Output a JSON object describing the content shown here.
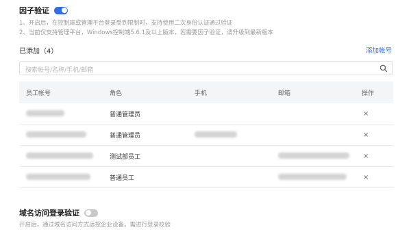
{
  "factor_auth": {
    "title": "因子验证",
    "enabled": true,
    "notes": [
      "1、开启后，在控制端或管理平台登录受到限制时，支持使用二次身份认证通过验证",
      "2、当前仅支持管理平台，Windows控制端5.6.1及以上版本，若需要因子验证，请升级到最新版本"
    ]
  },
  "added": {
    "label": "已添加（4）",
    "add_link": "添加帐号"
  },
  "search": {
    "placeholder": "搜索帐号/名称/手机/邮箱",
    "icon": "search-icon"
  },
  "table": {
    "headers": [
      "员工帐号",
      "角色",
      "手机",
      "邮箱",
      "操作"
    ],
    "rows": [
      {
        "role": "普通管理员",
        "has_phone": false,
        "has_email": false
      },
      {
        "role": "普通管理员",
        "has_phone": true,
        "has_email": false
      },
      {
        "role": "测试部员工",
        "has_phone": false,
        "has_email": true
      },
      {
        "role": "普通员工",
        "has_phone": false,
        "has_email": true
      }
    ],
    "action_symbol": "×"
  },
  "domain_auth": {
    "title": "域名访问登录验证",
    "enabled": false,
    "note": "开启后，通过域名访问方式远控企业设备，需进行登录校验"
  },
  "colors": {
    "accent": "#2f6fdf",
    "toggle_off": "#c9c9c9",
    "header_bg": "#f4f5f7"
  }
}
